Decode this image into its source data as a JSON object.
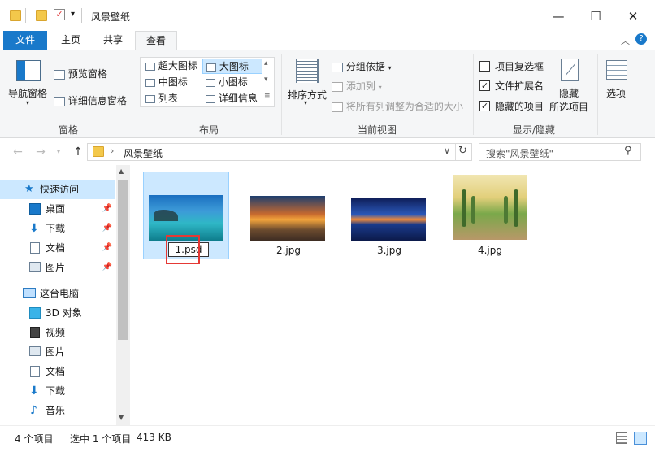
{
  "window": {
    "title": "风景壁纸",
    "controls": {
      "minimize": "—",
      "maximize": "☐",
      "close": "✕"
    }
  },
  "tabs": [
    {
      "label": "文件"
    },
    {
      "label": "主页"
    },
    {
      "label": "共享"
    },
    {
      "label": "查看"
    }
  ],
  "ribbon": {
    "panes": {
      "nav_pane": "导航窗格",
      "preview": "预览窗格",
      "details": "详细信息窗格",
      "group": "窗格"
    },
    "layout": {
      "items": [
        "超大图标",
        "大图标",
        "中图标",
        "小图标",
        "列表",
        "详细信息"
      ],
      "selected": "大图标",
      "group": "布局"
    },
    "current_view": {
      "sort": "排序方式",
      "group_by": "分组依据",
      "add_column": "添加列",
      "fit_columns": "将所有列调整为合适的大小",
      "group": "当前视图"
    },
    "show_hide": {
      "item_checkbox": "项目复选框",
      "item_checkbox_checked": false,
      "extensions": "文件扩展名",
      "extensions_checked": true,
      "hidden_items": "隐藏的项目",
      "hidden_items_checked": true,
      "hide_selected": "隐藏\n所选项目",
      "hide_line1": "隐藏",
      "hide_line2": "所选项目",
      "group": "显示/隐藏"
    },
    "options": "选项"
  },
  "address": {
    "path": "风景壁纸",
    "search_placeholder": "搜索\"风景壁纸\""
  },
  "nav": {
    "quick_access": "快速访问",
    "quick_items": [
      "桌面",
      "下载",
      "文档",
      "图片"
    ],
    "this_pc": "这台电脑",
    "pc_items": [
      "3D 对象",
      "视频",
      "图片",
      "文档",
      "下载",
      "音乐"
    ]
  },
  "files": [
    {
      "name": "1.psd",
      "selected": true,
      "renaming": true
    },
    {
      "name": "2.jpg"
    },
    {
      "name": "3.jpg"
    },
    {
      "name": "4.jpg"
    }
  ],
  "status": {
    "count": "4 个项目",
    "selected": "选中 1 个项目",
    "size": "413 KB"
  }
}
